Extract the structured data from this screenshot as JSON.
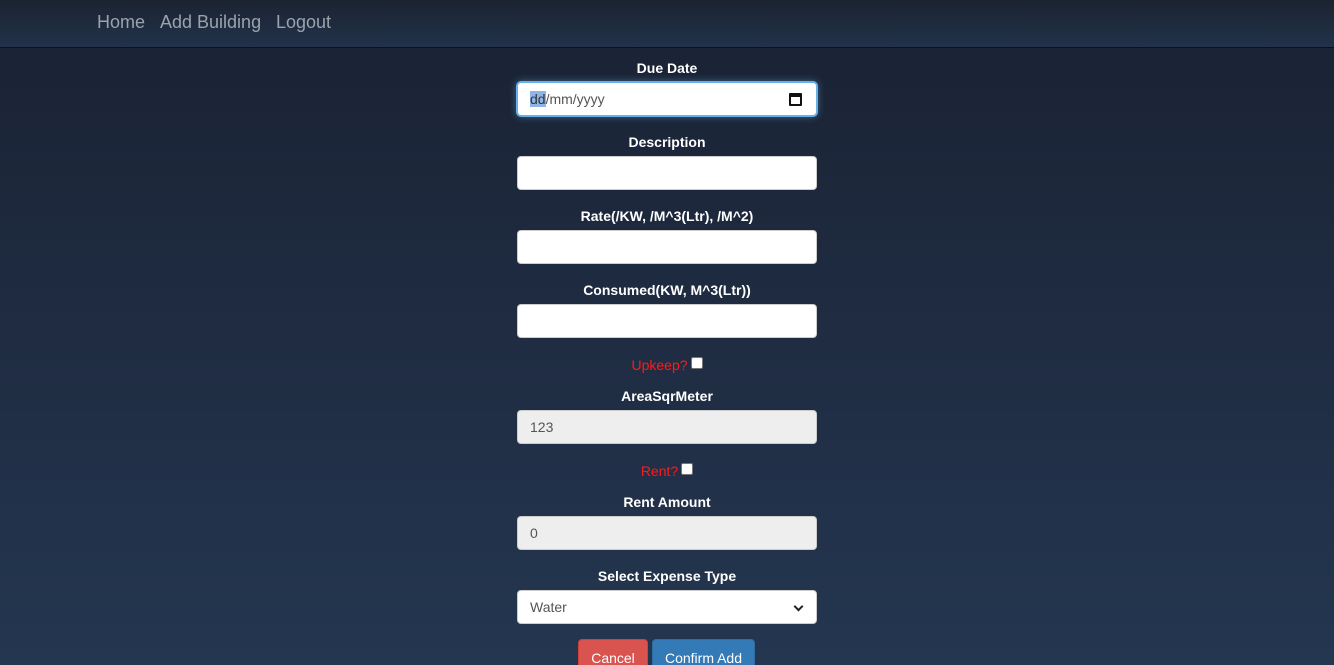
{
  "nav": {
    "links": [
      "Home",
      "Add Building",
      "Logout"
    ]
  },
  "form": {
    "due_date": {
      "label": "Due Date",
      "placeholder_selected": "dd",
      "placeholder_rest": "/mm/yyyy"
    },
    "description": {
      "label": "Description",
      "value": ""
    },
    "rate": {
      "label": "Rate(/KW, /M^3(Ltr), /M^2)",
      "value": ""
    },
    "consumed": {
      "label": "Consumed(KW, M^3(Ltr))",
      "value": ""
    },
    "upkeep": {
      "label": "Upkeep?",
      "checked": false
    },
    "area": {
      "label": "AreaSqrMeter",
      "value": "123"
    },
    "rent": {
      "label": "Rent?",
      "checked": false
    },
    "rent_amount": {
      "label": "Rent Amount",
      "value": "0"
    },
    "expense_type": {
      "label": "Select Expense Type",
      "selected": "Water"
    },
    "cancel_label": "Cancel",
    "confirm_label": "Confirm Add"
  },
  "colors": {
    "accent_red": "#ff1a1a",
    "cancel": "#d9534f",
    "confirm": "#337ab7"
  }
}
